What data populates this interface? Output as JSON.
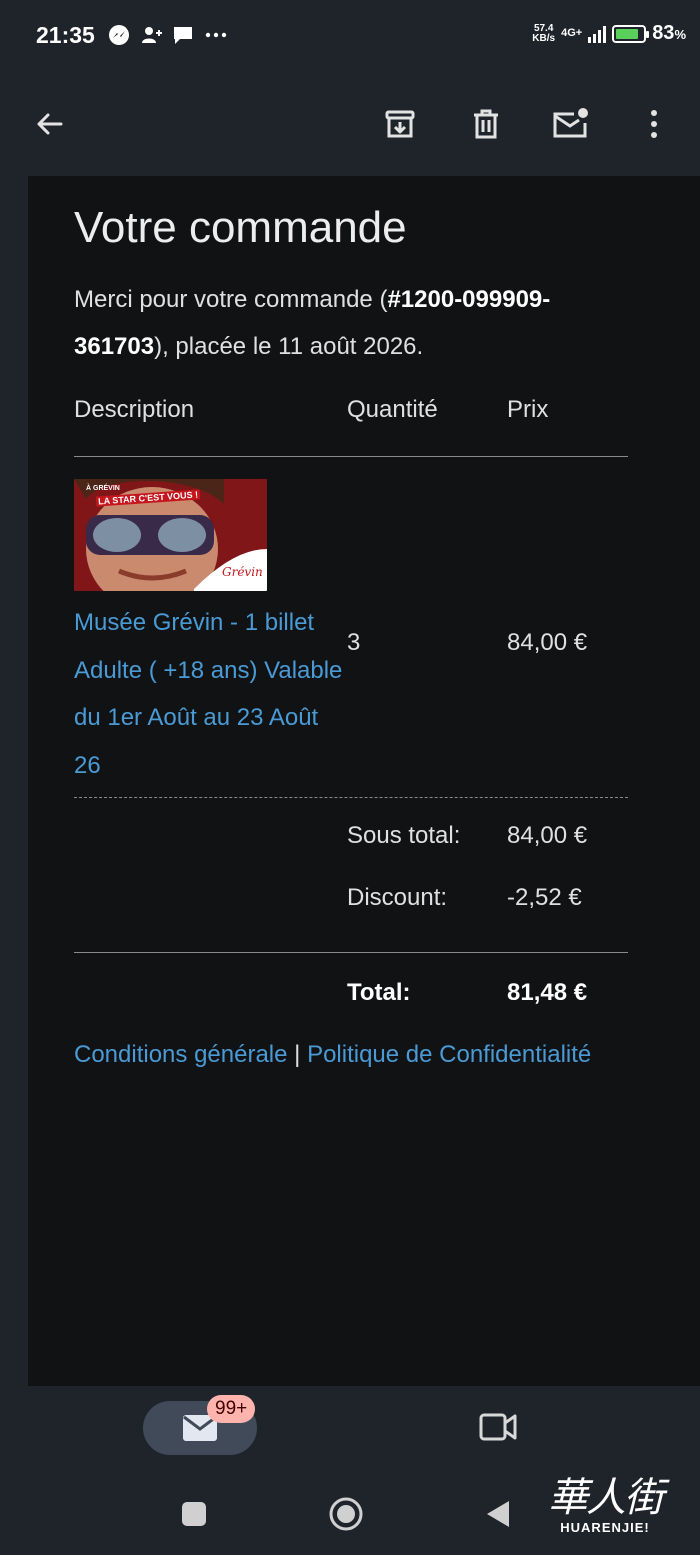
{
  "status_bar": {
    "time": "21:35",
    "net_speed_value": "57.4",
    "net_speed_unit": "KB/s",
    "network": "4G+",
    "battery_percent": "83",
    "battery_unit": "%",
    "battery_level": 0.83,
    "notification_icons": [
      "messenger-icon",
      "contact-icon",
      "chat-icon",
      "more-dots-icon"
    ]
  },
  "app_bar": {
    "icons": [
      "back-arrow-icon",
      "archive-icon",
      "delete-icon",
      "mark-unread-icon",
      "more-vert-icon"
    ]
  },
  "email": {
    "title": "Votre commande",
    "intro_before": "Merci pour votre commande (",
    "order_number": "#1200-099909-361703",
    "intro_after": "), placée le 11 août 2026.",
    "table": {
      "headers": {
        "description": "Description",
        "quantity": "Quantité",
        "price": "Prix"
      },
      "items": [
        {
          "image_text_line1": "À GRÉVIN",
          "image_text_line2": "LA STAR C'EST VOUS !",
          "image_logo": "Grévin",
          "name": "Musée Grévin - 1 billet Adulte ( +18 ans) Valable du 1er Août au 23 Août 26",
          "quantity": "3",
          "price": "84,00 €"
        }
      ]
    },
    "summary": {
      "subtotal_label": "Sous total:",
      "subtotal_value": "84,00 €",
      "discount_label": "Discount:",
      "discount_value": "-2,52 €",
      "total_label": "Total:",
      "total_value": "81,48 €"
    },
    "footer": {
      "terms_link": "Conditions générale",
      "separator": "|",
      "privacy_link": "Politique de Confidentialité"
    }
  },
  "bottom_nav": {
    "mail_badge": "99+",
    "tabs": [
      "mail-icon",
      "video-icon"
    ]
  },
  "system_nav": [
    "recents-icon",
    "home-icon",
    "back-icon"
  ],
  "watermark": {
    "chinese": "華人街",
    "latin": "HUARENJIE!"
  },
  "colors": {
    "background": "#1f242b",
    "content_background": "#111214",
    "link": "#4a9bd5",
    "badge": "#ffb3ad",
    "battery_fill": "#58d05a"
  }
}
